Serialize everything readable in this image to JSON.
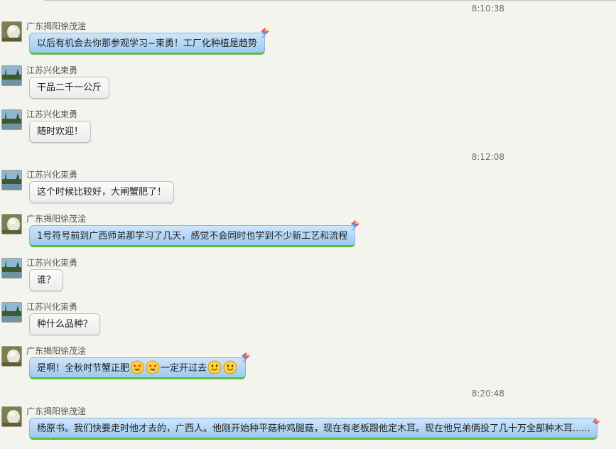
{
  "timestamps": [
    "8:10:38",
    "8:12:08",
    "8:20:48"
  ],
  "senders": {
    "guangdong": "广东揭阳徐茂淦",
    "jiangsu": "江苏兴化束勇"
  },
  "messages": [
    {
      "text": "以后有机会去你那参观学习~束勇！工厂化种植是趋势"
    },
    {
      "text": "干品二千一公斤"
    },
    {
      "text": "随时欢迎！"
    },
    {
      "text": "这个时候比较好，大闸蟹肥了！"
    },
    {
      "text": "1号符号前到广西师弟那学习了几天，感觉不会同时也学到不少新工艺和流程"
    },
    {
      "text": "谁？"
    },
    {
      "text": "种什么品种？"
    },
    {
      "text_a": "是啊！全秋时节蟹正肥",
      "text_b": "一定开过去"
    },
    {
      "text": "杨原书。我们快要走时他才去的，广西人。他刚开始种平菇种鸡腿菇，现在有老板跟他定木耳。现在他兄弟俩投了几十万全部种木耳......"
    }
  ],
  "icons": {
    "kite": "kite-icon",
    "drool_emoji": "drooling-face-emoji",
    "smile_emoji": "smiling-face-emoji"
  },
  "colors": {
    "background": "#f3f4ed",
    "own_bubble": "#a9d2f5",
    "own_bubble_accent": "#5bbf3a",
    "other_bubble": "#f3f3f3"
  }
}
